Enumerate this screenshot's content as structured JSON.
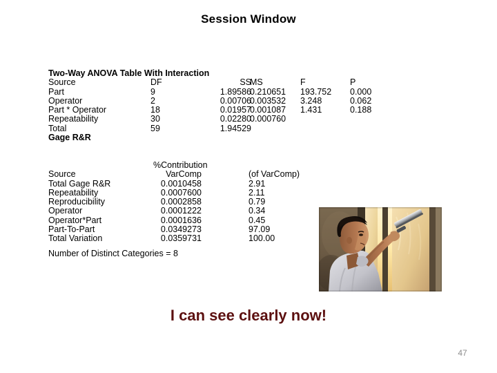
{
  "slide": {
    "title": "Session Window",
    "page_number": "47",
    "caption": "I can see clearly now!",
    "caption_color": "#5C1010",
    "page_number_color": "#8C8C8C",
    "background_color": "#FFFFFF"
  },
  "anova": {
    "heading": "Two-Way ANOVA Table With Interaction",
    "columns": [
      "Source",
      "DF",
      "SS",
      "MS",
      "F",
      "P"
    ],
    "rows": [
      {
        "source": "Part",
        "df": "9",
        "ss": "1.89586",
        "ms": "0.210651",
        "f": "193.752",
        "p": "0.000"
      },
      {
        "source": "Operator",
        "df": "2",
        "ss": "0.00706",
        "ms": "0.003532",
        "f": "3.248",
        "p": "0.062"
      },
      {
        "source": "Part * Operator",
        "df": "18",
        "ss": "0.01957",
        "ms": "0.001087",
        "f": "1.431",
        "p": "0.188"
      },
      {
        "source": "Repeatability",
        "df": "30",
        "ss": "0.02280",
        "ms": "0.000760",
        "f": "",
        "p": ""
      },
      {
        "source": "Total",
        "df": "59",
        "ss": "1.94529",
        "ms": "",
        "f": "",
        "p": ""
      }
    ]
  },
  "gage": {
    "heading": "Gage R&R",
    "pct_header": "%Contribution",
    "columns": [
      "Source",
      "VarComp",
      "(of VarComp)"
    ],
    "rows": [
      {
        "source": "Total Gage R&R",
        "varcomp": "0.0010458",
        "pct": "2.91"
      },
      {
        "source": "Repeatability",
        "varcomp": "0.0007600",
        "pct": "2.11"
      },
      {
        "source": "Reproducibility",
        "varcomp": "0.0002858",
        "pct": "0.79"
      },
      {
        "source": "Operator",
        "varcomp": "0.0001222",
        "pct": "0.34"
      },
      {
        "source": "Operator*Part",
        "varcomp": "0.0001636",
        "pct": "0.45"
      },
      {
        "source": "Part-To-Part",
        "varcomp": "0.0349273",
        "pct": "97.09"
      },
      {
        "source": "Total Variation",
        "varcomp": "0.0359731",
        "pct": "100.00"
      }
    ]
  },
  "distinct_categories": "Number of Distinct Categories = 8",
  "photo": {
    "alt": "man cleaning a window with a squeegee",
    "wall_color": "#6b5a44",
    "window_light_color": "#f3d79b",
    "skin_color": "#a9714c",
    "shirt_color": "#cdcdd2",
    "hair_color": "#120d0a"
  }
}
